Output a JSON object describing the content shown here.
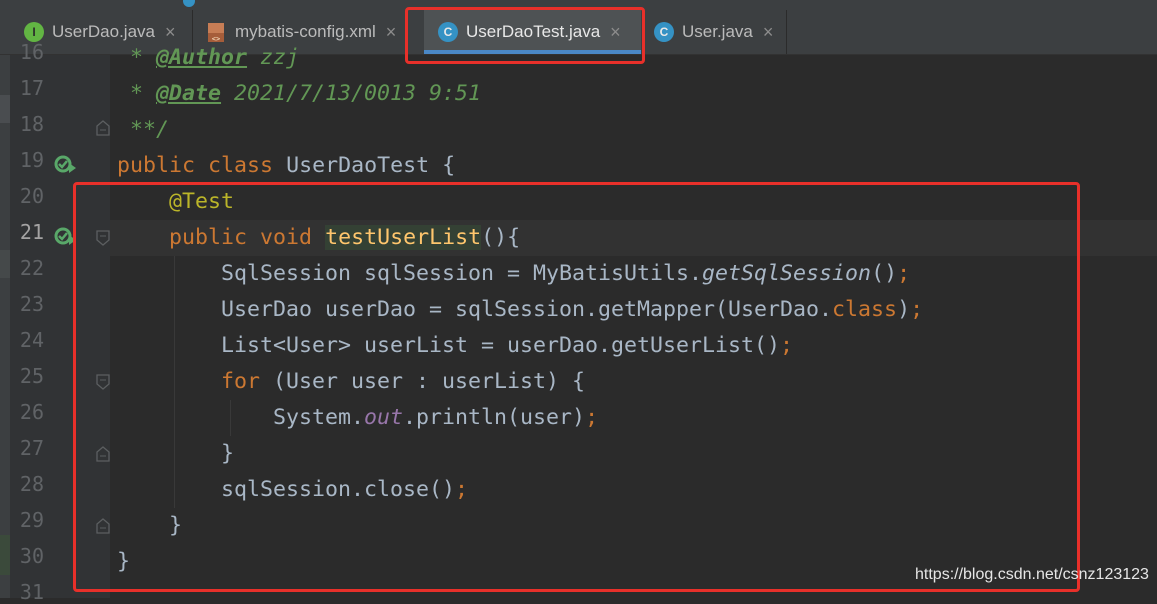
{
  "tabs": [
    {
      "label": "UserDao.java",
      "icon": "interface-icon",
      "icon_letter": "I",
      "active": false
    },
    {
      "label": "mybatis-config.xml",
      "icon": "xml-file-icon",
      "active": false
    },
    {
      "label": "UserDaoTest.java",
      "icon": "test-class-icon",
      "icon_letter": "C",
      "active": true
    },
    {
      "label": "User.java",
      "icon": "class-icon",
      "icon_letter": "C",
      "active": false
    }
  ],
  "tab_close_glyph": "×",
  "editor": {
    "current_line": "21",
    "lines": [
      {
        "num": "16",
        "parts": []
      },
      {
        "num": "17",
        "parts": []
      },
      {
        "num": "18",
        "parts": []
      },
      {
        "num": "19",
        "parts": []
      },
      {
        "num": "20",
        "parts": []
      },
      {
        "num": "21",
        "parts": []
      },
      {
        "num": "22",
        "parts": []
      },
      {
        "num": "23",
        "parts": []
      },
      {
        "num": "24",
        "parts": []
      },
      {
        "num": "25",
        "parts": []
      },
      {
        "num": "26",
        "parts": []
      },
      {
        "num": "27",
        "parts": []
      },
      {
        "num": "28",
        "parts": []
      },
      {
        "num": "29",
        "parts": []
      },
      {
        "num": "30",
        "parts": []
      },
      {
        "num": "31",
        "parts": []
      }
    ],
    "code": {
      "l16": {
        "prefix": " * ",
        "tag": "@Author",
        "rest": " zzj"
      },
      "l17": {
        "prefix": " * ",
        "tag": "@Date",
        "rest": " 2021/7/13/0013 9:51"
      },
      "l18": {
        "text": " **/"
      },
      "l19": {
        "kw1": "public",
        "kw2": "class",
        "name": "UserDaoTest",
        "brace": " {"
      },
      "l20": {
        "indent": "    ",
        "ann": "@Test"
      },
      "l21": {
        "indent": "    ",
        "kw1": "public",
        "kw2": "void",
        "method": "testUserList",
        "rest": "(){"
      },
      "l22": {
        "indent": "        ",
        "a": "SqlSession sqlSession = MyBatisUtils.",
        "call": "getSqlSession",
        "b": "()",
        "semi": ";"
      },
      "l23": {
        "indent": "        ",
        "a": "UserDao userDao = sqlSession.getMapper(UserDao.",
        "kw": "class",
        "b": ")",
        "semi": ";"
      },
      "l24": {
        "indent": "        ",
        "a": "List<User> userList = userDao.getUserList()",
        "semi": ";"
      },
      "l25": {
        "indent": "        ",
        "kw": "for",
        "a": " (User user : userList) {"
      },
      "l26": {
        "indent": "            ",
        "a": "System.",
        "fld": "out",
        "b": ".println(user)",
        "semi": ";"
      },
      "l27": {
        "indent": "        ",
        "a": "}"
      },
      "l28": {
        "indent": "        ",
        "a": "sqlSession.close()",
        "semi": ";"
      },
      "l29": {
        "indent": "    ",
        "a": "}"
      },
      "l30": {
        "a": "}"
      }
    }
  },
  "watermark": "https://blog.csdn.net/csnz123123",
  "colors": {
    "keyword": "#cc7832",
    "annotation": "#bbb529",
    "comment": "#629755",
    "field": "#9876aa",
    "method_decl": "#ffc66d",
    "text": "#a9b7c6",
    "highlight_box": "#e8302a",
    "tab_accent": "#4a88c7"
  }
}
